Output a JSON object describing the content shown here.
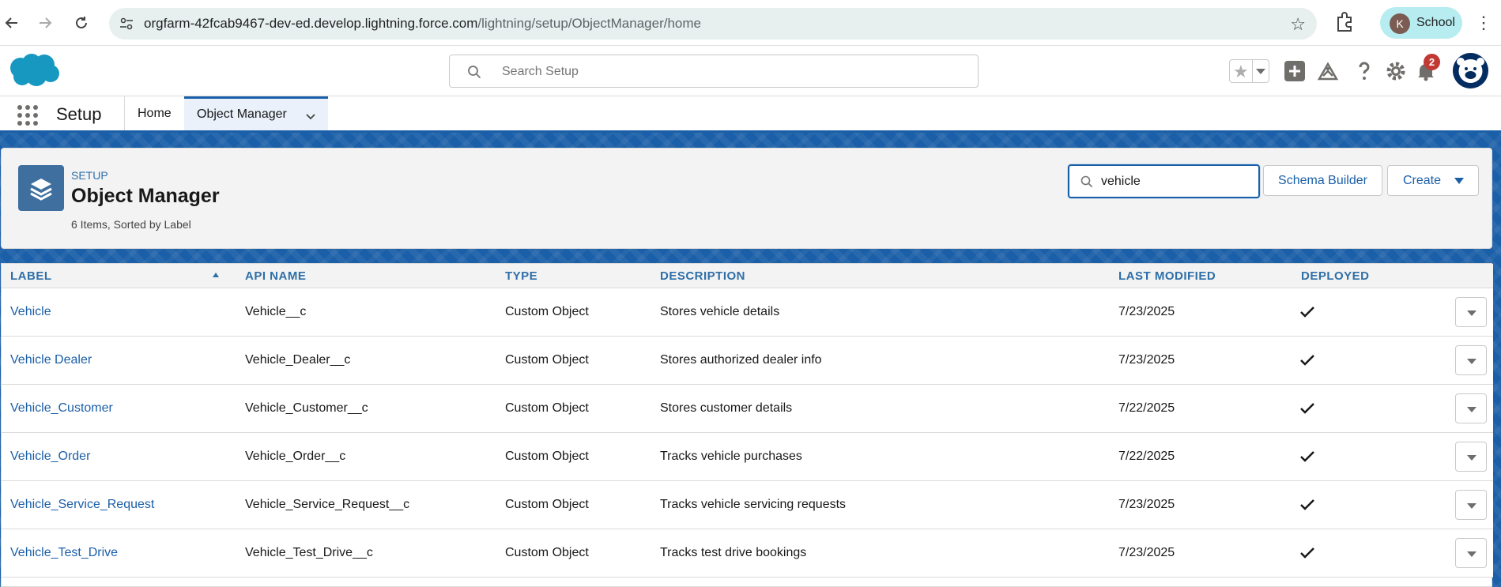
{
  "browser": {
    "url_host": "orgfarm-42fcab9467-dev-ed.develop.lightning.force.com",
    "url_path": "/lightning/setup/ObjectManager/home",
    "profile_initial": "K",
    "profile_name": "School"
  },
  "header": {
    "search_placeholder": "Search Setup",
    "notification_count": "2"
  },
  "app_nav": {
    "app_name": "Setup",
    "tabs": [
      {
        "label": "Home"
      },
      {
        "label": "Object Manager"
      }
    ]
  },
  "page_header": {
    "breadcrumb": "SETUP",
    "title": "Object Manager",
    "meta": "6 Items, Sorted by Label",
    "quick_find_value": "vehicle",
    "schema_builder_label": "Schema Builder",
    "create_label": "Create"
  },
  "table": {
    "columns": [
      "LABEL",
      "API NAME",
      "TYPE",
      "DESCRIPTION",
      "LAST MODIFIED",
      "DEPLOYED"
    ],
    "rows": [
      {
        "label": "Vehicle",
        "api_name": "Vehicle__c",
        "type": "Custom Object",
        "description": "Stores vehicle details",
        "last_modified": "7/23/2025",
        "deployed": true
      },
      {
        "label": "Vehicle Dealer",
        "api_name": "Vehicle_Dealer__c",
        "type": "Custom Object",
        "description": "Stores authorized dealer info",
        "last_modified": "7/23/2025",
        "deployed": true
      },
      {
        "label": "Vehicle_Customer",
        "api_name": "Vehicle_Customer__c",
        "type": "Custom Object",
        "description": "Stores customer details",
        "last_modified": "7/22/2025",
        "deployed": true
      },
      {
        "label": "Vehicle_Order",
        "api_name": "Vehicle_Order__c",
        "type": "Custom Object",
        "description": "Tracks vehicle purchases",
        "last_modified": "7/22/2025",
        "deployed": true
      },
      {
        "label": "Vehicle_Service_Request",
        "api_name": "Vehicle_Service_Request__c",
        "type": "Custom Object",
        "description": "Tracks vehicle servicing requests",
        "last_modified": "7/23/2025",
        "deployed": true
      },
      {
        "label": "Vehicle_Test_Drive",
        "api_name": "Vehicle_Test_Drive__c",
        "type": "Custom Object",
        "description": "Tracks test drive bookings",
        "last_modified": "7/23/2025",
        "deployed": true
      }
    ]
  },
  "colors": {
    "brand_blue": "#1b5fa8",
    "link_blue": "#2e6fa8",
    "badge_red": "#c23934"
  }
}
